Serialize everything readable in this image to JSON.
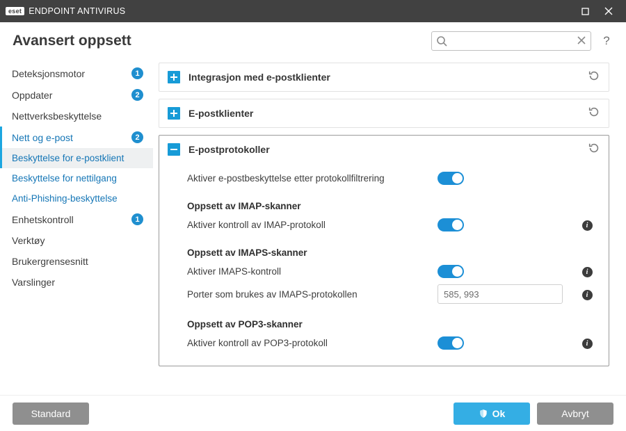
{
  "titlebar": {
    "logo_text": "eset",
    "product": "ENDPOINT ANTIVIRUS"
  },
  "header": {
    "page_title": "Avansert oppsett",
    "search_placeholder": "",
    "help_label": "?"
  },
  "sidebar": {
    "items": [
      {
        "label": "Deteksjonsmotor",
        "badge": "1",
        "type": "parent"
      },
      {
        "label": "Oppdater",
        "badge": "2",
        "type": "parent"
      },
      {
        "label": "Nettverksbeskyttelse",
        "type": "parent"
      },
      {
        "label": "Nett og e-post",
        "badge": "2",
        "type": "parent",
        "active_trail": true
      },
      {
        "label": "Beskyttelse for e-postklient",
        "type": "child",
        "selected": true
      },
      {
        "label": "Beskyttelse for nettilgang",
        "type": "child"
      },
      {
        "label": "Anti-Phishing-beskyttelse",
        "type": "child"
      },
      {
        "label": "Enhetskontroll",
        "badge": "1",
        "type": "parent"
      },
      {
        "label": "Verktøy",
        "type": "parent"
      },
      {
        "label": "Brukergrensesnitt",
        "type": "parent"
      },
      {
        "label": "Varslinger",
        "type": "parent"
      }
    ]
  },
  "panels": {
    "integration": {
      "title": "Integrasjon med e-postklienter",
      "expanded": false
    },
    "clients": {
      "title": "E-postklienter",
      "expanded": false
    },
    "protocols": {
      "title": "E-postprotokoller",
      "expanded": true,
      "rows": {
        "enable_protocol_filter": {
          "label": "Aktiver e-postbeskyttelse etter protokollfiltrering",
          "toggle": true
        },
        "imap_heading": {
          "label": "Oppsett av IMAP-skanner"
        },
        "imap_enable": {
          "label": "Aktiver kontroll av IMAP-protokoll",
          "toggle": true,
          "info": true
        },
        "imaps_heading": {
          "label": "Oppsett av IMAPS-skanner"
        },
        "imaps_enable": {
          "label": "Aktiver IMAPS-kontroll",
          "toggle": true,
          "info": true
        },
        "imaps_ports": {
          "label": "Porter som brukes av IMAPS-protokollen",
          "value": "585, 993",
          "info": true
        },
        "pop3_heading": {
          "label": "Oppsett av POP3-skanner"
        },
        "pop3_enable": {
          "label": "Aktiver kontroll av POP3-protokoll",
          "toggle": true,
          "info": true
        }
      }
    }
  },
  "footer": {
    "default_label": "Standard",
    "ok_label": "Ok",
    "cancel_label": "Avbryt"
  }
}
